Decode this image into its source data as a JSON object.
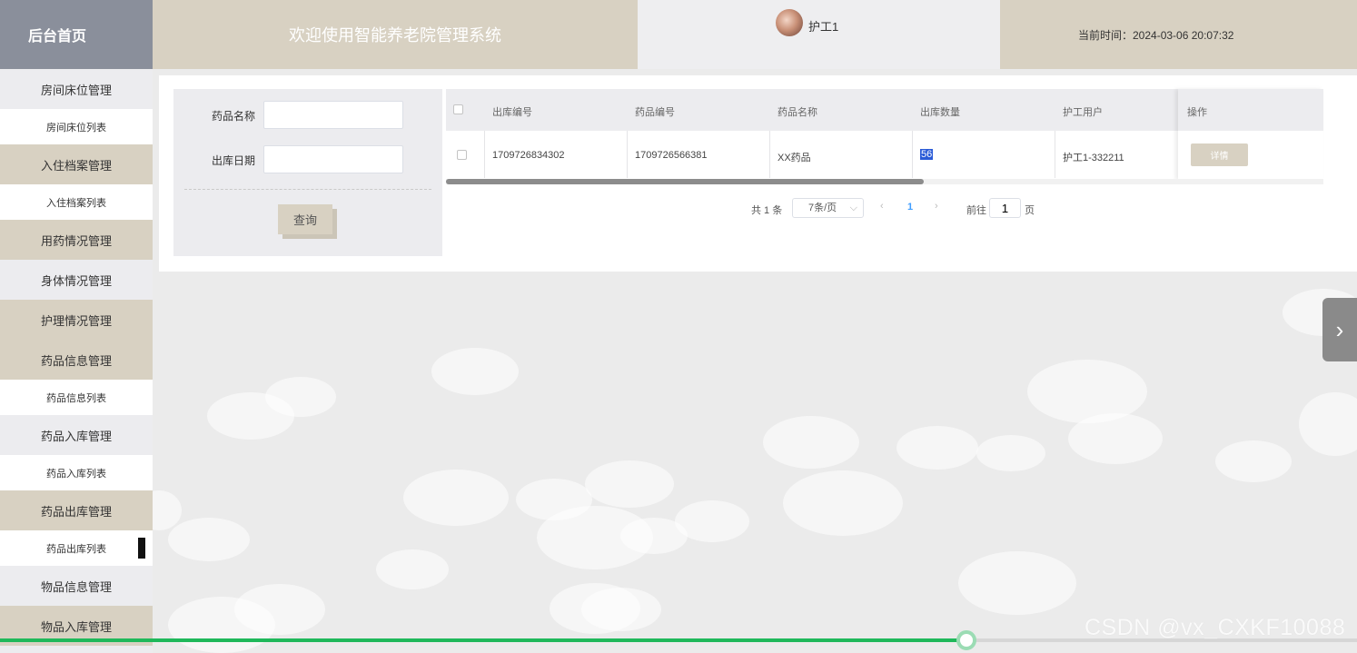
{
  "sidebar": {
    "logo": "后台首页",
    "items": [
      {
        "label": "房间床位管理",
        "type": "group-light"
      },
      {
        "label": "房间床位列表",
        "type": "sub"
      },
      {
        "label": "入住档案管理",
        "type": "group"
      },
      {
        "label": "入住档案列表",
        "type": "sub"
      },
      {
        "label": "用药情况管理",
        "type": "group"
      },
      {
        "label": "身体情况管理",
        "type": "group-light"
      },
      {
        "label": "护理情况管理",
        "type": "group"
      },
      {
        "label": "药品信息管理",
        "type": "group"
      },
      {
        "label": "药品信息列表",
        "type": "sub"
      },
      {
        "label": "药品入库管理",
        "type": "group-light"
      },
      {
        "label": "药品入库列表",
        "type": "sub"
      },
      {
        "label": "药品出库管理",
        "type": "group"
      },
      {
        "label": "药品出库列表",
        "type": "sub-active"
      },
      {
        "label": "物品信息管理",
        "type": "group-light"
      },
      {
        "label": "物品入库管理",
        "type": "group"
      }
    ]
  },
  "header": {
    "welcome": "欢迎使用智能养老院管理系统",
    "username": "护工1",
    "current_time": "当前时间：2024-03-06 20:07:32"
  },
  "search": {
    "drug_name_label": "药品名称",
    "drug_name_value": "",
    "outbound_date_label": "出库日期",
    "outbound_date_value": "",
    "query_button": "查询"
  },
  "table": {
    "columns": [
      "出库编号",
      "药品编号",
      "药品名称",
      "出库数量",
      "护工用户",
      "操作"
    ],
    "rows": [
      {
        "outbound_no": "1709726834302",
        "drug_no": "1709726566381",
        "drug_name": "XX药品",
        "quantity": "56",
        "nurse_user": "护工1-332211",
        "action": "详情"
      }
    ]
  },
  "pagination": {
    "total": "共 1 条",
    "page_size": "7条/页",
    "current_page": "1",
    "goto_label": "前往",
    "goto_value": "1",
    "page_unit": "页"
  },
  "watermark": "CSDN @vx_CXKF10088",
  "video_progress": 0.712,
  "colors": {
    "accent": "#d8d1c2",
    "sidebar_header": "#8a8f9b",
    "progress": "#1fb85a",
    "selection": "#2a5bd7"
  }
}
